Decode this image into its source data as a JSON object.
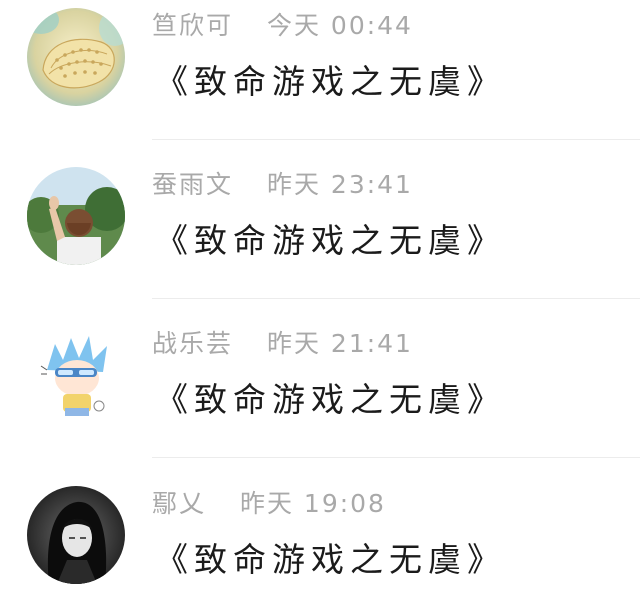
{
  "comments": [
    {
      "name": "笪欣可",
      "time": "今天 00:44",
      "text": "《致命游戏之无虞》",
      "avatar": "seashell-avatar"
    },
    {
      "name": "蚕雨文",
      "time": "昨天 23:41",
      "text": "《致命游戏之无虞》",
      "avatar": "person-waving-avatar"
    },
    {
      "name": "战乐芸",
      "time": "昨天 21:41",
      "text": "《致命游戏之无虞》",
      "avatar": "anime-chibi-avatar"
    },
    {
      "name": "鄢乂",
      "time": "昨天 19:08",
      "text": "《致命游戏之无虞》",
      "avatar": "anime-dark-hair-avatar"
    }
  ],
  "colors": {
    "meta_text": "#a9a9a9",
    "comment_text": "#1b1b1b",
    "divider": "#ececec",
    "background": "#ffffff"
  }
}
